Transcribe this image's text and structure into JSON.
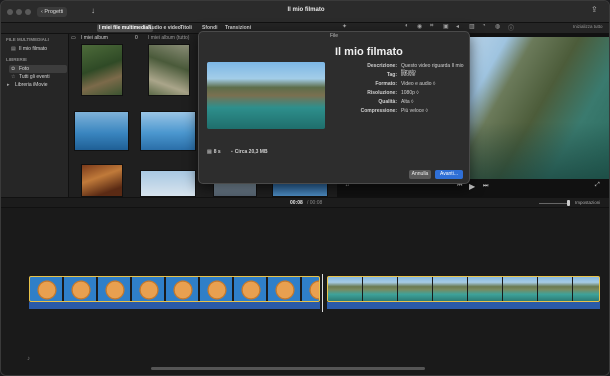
{
  "window": {
    "title": "Il mio filmato",
    "back_label": "‹ Progetti"
  },
  "toolbar": {
    "tabs": [
      "I miei file multimediali",
      "Audio e video",
      "Titoli",
      "Sfondi",
      "Transizioni"
    ],
    "reset_all": "Inizializza tutto"
  },
  "sidebar": {
    "section1": "FILE MULTIMEDIALI",
    "project_item": "Il mio filmato",
    "section2": "LIBRERIE",
    "photos": "Foto",
    "all_events": "Tutti gli eventi",
    "library": "Libreria iMovie"
  },
  "browser": {
    "album_label": "I miei album",
    "album_count": "0",
    "album_all": "I miei album (tutto)"
  },
  "modal": {
    "header": "File",
    "title": "Il mio filmato",
    "rows": [
      {
        "label": "Descrizione:",
        "value": "Questo video riguarda Il mio filmato"
      },
      {
        "label": "Tag:",
        "value": "iMovie"
      },
      {
        "label": "Formato:",
        "value": "Video e audio ◊"
      },
      {
        "label": "Risoluzione:",
        "value": "1080p ◊"
      },
      {
        "label": "Qualità:",
        "value": "Alta ◊"
      },
      {
        "label": "Compressione:",
        "value": "Più veloce ◊"
      }
    ],
    "duration": "8 s",
    "size": "Circa 20,3 MB",
    "cancel": "Annulla",
    "next": "Avanti..."
  },
  "timeline": {
    "current": "00:08",
    "total": "/ 00:08",
    "settings": "Impostazioni"
  },
  "colors": {
    "accent": "#2f6fd6",
    "clip_border": "#e8c24a",
    "audio": "#2a5aa8"
  }
}
